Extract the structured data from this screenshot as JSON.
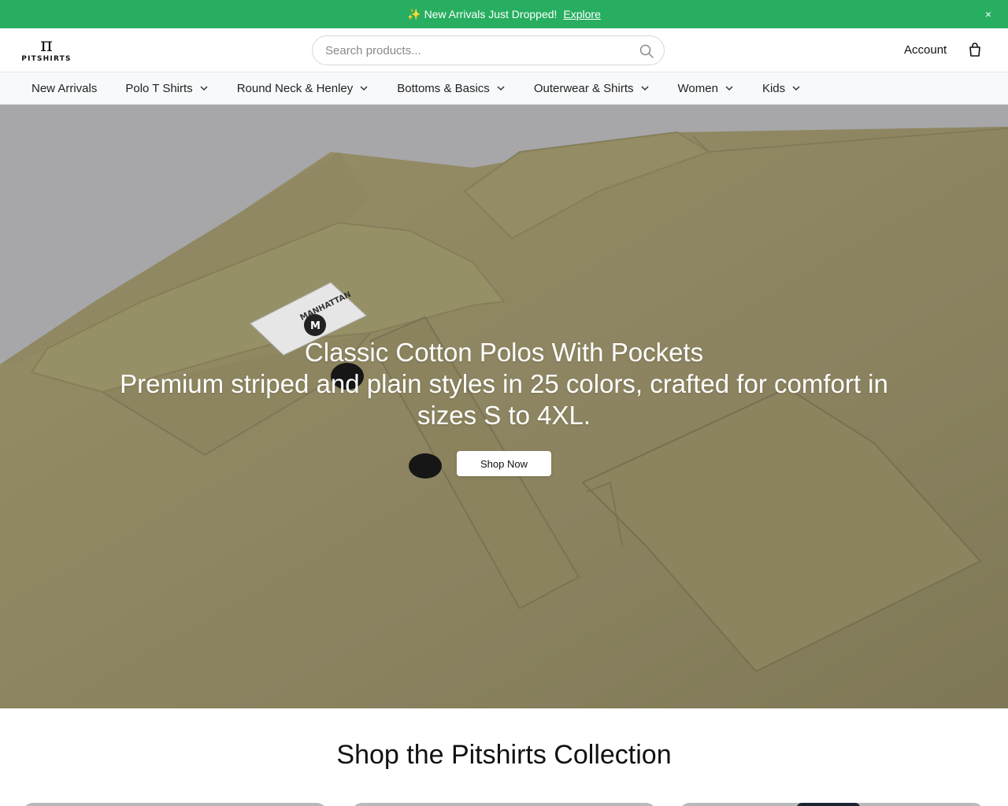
{
  "announcement": {
    "sparkle": "✨",
    "text": "New Arrivals Just Dropped!",
    "link": "Explore",
    "close": "×"
  },
  "header": {
    "logo_symbol": "π",
    "logo_word": "PITSHIRTS",
    "search_placeholder": "Search products...",
    "account": "Account",
    "icons": {
      "search": "search-icon",
      "bag": "shopping-bag-icon"
    }
  },
  "nav": {
    "items": [
      {
        "label": "New Arrivals",
        "has_dropdown": false
      },
      {
        "label": "Polo T Shirts",
        "has_dropdown": true
      },
      {
        "label": "Round Neck & Henley",
        "has_dropdown": true
      },
      {
        "label": "Bottoms & Basics",
        "has_dropdown": true
      },
      {
        "label": "Outerwear & Shirts",
        "has_dropdown": true
      },
      {
        "label": "Women",
        "has_dropdown": true
      },
      {
        "label": "Kids",
        "has_dropdown": true
      }
    ]
  },
  "hero": {
    "title": "Classic Cotton Polos With Pockets",
    "subtitle": "Premium striped and plain styles in 25 colors, crafted for comfort in sizes S to 4XL.",
    "cta": "Shop Now",
    "tag_brand": "MANHATTAN",
    "tag_size": "M"
  },
  "collection": {
    "title": "Shop the Pitshirts Collection"
  },
  "colors": {
    "announcement_bg": "#27ae60",
    "shirt_olive": "#8e8660",
    "hero_backdrop": "#a7a7a9"
  }
}
